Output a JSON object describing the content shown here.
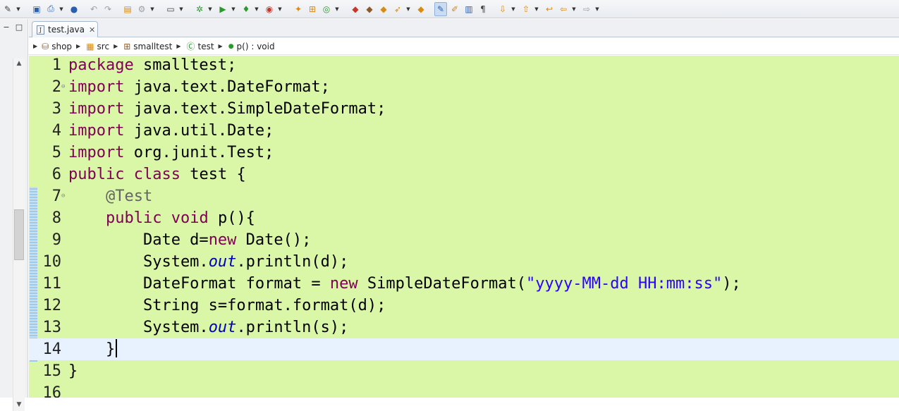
{
  "toolbar": {
    "icons": [
      "new-wizard-icon",
      "save-all-icon",
      "print-icon",
      "web-browser-icon",
      "undo-icon",
      "redo-icon",
      "properties-icon",
      "search-icon",
      "open-console-icon",
      "debug-icon",
      "run-icon",
      "run-external-icon",
      "coverage-icon",
      "new-java-project-icon",
      "new-package-icon",
      "new-class-icon",
      "open-type-icon",
      "open-task-icon",
      "open-perspective-icon",
      "mark-occurrences-icon",
      "highlight-icon",
      "block-selection-icon",
      "show-whitespace-icon",
      "next-annotation-icon",
      "prev-annotation-icon",
      "last-edit-icon",
      "back-icon",
      "forward-icon"
    ]
  },
  "tabs": [
    {
      "label": "test.java",
      "active": true
    }
  ],
  "breadcrumb": [
    {
      "label": "shop",
      "icon": "project-icon"
    },
    {
      "label": "src",
      "icon": "source-folder-icon"
    },
    {
      "label": "smalltest",
      "icon": "package-icon"
    },
    {
      "label": "test",
      "icon": "class-icon"
    },
    {
      "label": "p() : void",
      "icon": "method-icon"
    }
  ],
  "editor": {
    "current_line": 14,
    "lines": [
      {
        "n": "1",
        "code": [
          [
            "kw",
            "package"
          ],
          [
            "t",
            " smalltest;"
          ]
        ]
      },
      {
        "n": "2",
        "fold": true,
        "code": [
          [
            "kw",
            "import"
          ],
          [
            "t",
            " java.text.DateFormat;"
          ]
        ]
      },
      {
        "n": "3",
        "code": [
          [
            "kw",
            "import"
          ],
          [
            "t",
            " java.text.SimpleDateFormat;"
          ]
        ]
      },
      {
        "n": "4",
        "code": [
          [
            "kw",
            "import"
          ],
          [
            "t",
            " java.util.Date;"
          ]
        ]
      },
      {
        "n": "5",
        "code": [
          [
            "kw",
            "import"
          ],
          [
            "t",
            " org.junit.Test;"
          ]
        ]
      },
      {
        "n": "6",
        "code": [
          [
            "kw",
            "public"
          ],
          [
            "t",
            " "
          ],
          [
            "kw",
            "class"
          ],
          [
            "t",
            " test {"
          ]
        ]
      },
      {
        "n": "7",
        "fold": true,
        "code": [
          [
            "t",
            "    "
          ],
          [
            "ann",
            "@Test"
          ]
        ]
      },
      {
        "n": "8",
        "code": [
          [
            "t",
            "    "
          ],
          [
            "kw",
            "public"
          ],
          [
            "t",
            " "
          ],
          [
            "kw",
            "void"
          ],
          [
            "t",
            " p(){"
          ]
        ]
      },
      {
        "n": "9",
        "code": [
          [
            "t",
            "        Date d="
          ],
          [
            "kw",
            "new"
          ],
          [
            "t",
            " Date();"
          ]
        ]
      },
      {
        "n": "10",
        "code": [
          [
            "t",
            "        System."
          ],
          [
            "fld",
            "out"
          ],
          [
            "t",
            ".println(d);"
          ]
        ]
      },
      {
        "n": "11",
        "code": [
          [
            "t",
            "        DateFormat format = "
          ],
          [
            "kw",
            "new"
          ],
          [
            "t",
            " SimpleDateFormat("
          ],
          [
            "str",
            "\"yyyy-MM-dd HH:mm:ss\""
          ],
          [
            "t",
            ");"
          ]
        ]
      },
      {
        "n": "12",
        "code": [
          [
            "t",
            "        String s=format.format(d);"
          ]
        ]
      },
      {
        "n": "13",
        "code": [
          [
            "t",
            "        System."
          ],
          [
            "fld",
            "out"
          ],
          [
            "t",
            ".println(s);"
          ]
        ]
      },
      {
        "n": "14",
        "caret": true,
        "code": [
          [
            "t",
            "    }"
          ]
        ]
      },
      {
        "n": "15",
        "code": [
          [
            "t",
            "}"
          ]
        ]
      },
      {
        "n": "16",
        "code": []
      }
    ]
  }
}
